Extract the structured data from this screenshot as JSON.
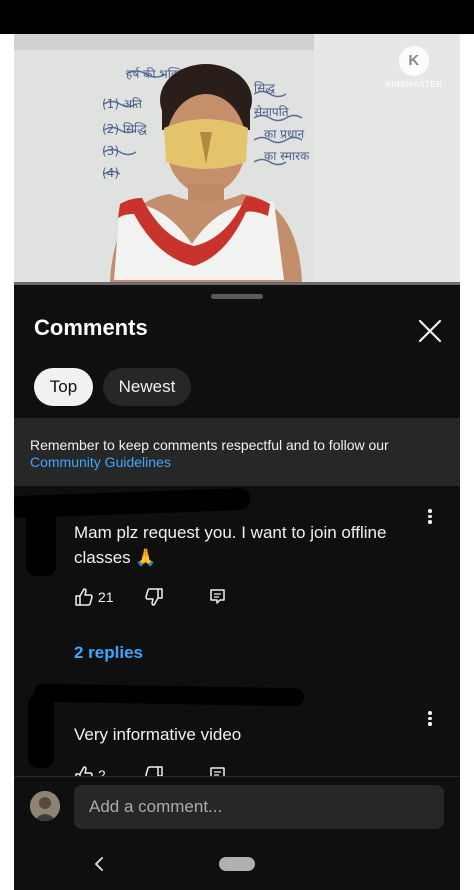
{
  "video": {
    "watermark": "KINEMASTER",
    "watermark_letter": "K",
    "board_lines": [
      "हर्ष की भक्तिपरिचर",
      "(1) अति",
      "(2) सिद्धि",
      "(3)",
      "(4)",
      "सिद्ध",
      "सेनापति",
      "का प्रधान",
      "का स्मारक"
    ]
  },
  "sheet": {
    "title": "Comments",
    "chips": [
      {
        "label": "Top",
        "selected": true
      },
      {
        "label": "Newest",
        "selected": false
      }
    ],
    "notice": {
      "text": "Remember to keep comments respectful and to follow our",
      "link": "Community Guidelines"
    }
  },
  "comments": [
    {
      "text_line1": "Mam plz request you. I want to join offline",
      "text_line2": "classes 🙏",
      "likes": "21",
      "replies": "2 replies"
    },
    {
      "text_line1": "Very informative video",
      "likes": "2"
    }
  ],
  "composer": {
    "placeholder": "Add a comment..."
  },
  "colors": {
    "background": "#0f0f0f",
    "surface": "#272727",
    "link": "#3ea6ff",
    "text": "#f1f1f1"
  }
}
